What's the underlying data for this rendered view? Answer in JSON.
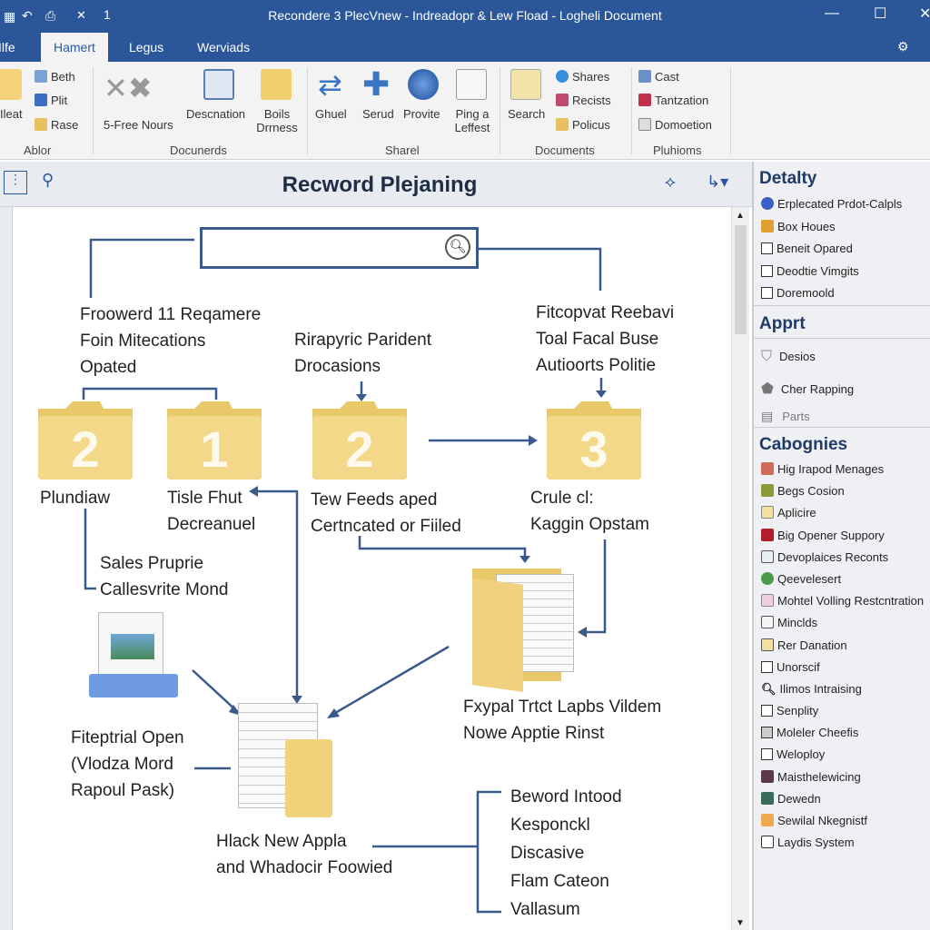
{
  "window": {
    "title": "Recondere 3 PlecVnew - Indreadopr & Lew Fload - Logheli Document",
    "quick_access": "1"
  },
  "tabs": [
    "Ilfe",
    "Hamert",
    "Legus",
    "Werviads"
  ],
  "ribbon": {
    "groups": [
      {
        "label": "Ablor",
        "items": [
          "Ileat",
          "Beth",
          "Plit",
          "Rase"
        ]
      },
      {
        "label": "Docunerds",
        "items": [
          "5-Free Nours",
          "Descnation",
          "Boils Drrness"
        ]
      },
      {
        "label": "Sharel",
        "items": [
          "Ghuel",
          "Serud",
          "Provite",
          "Ping a Leffest"
        ]
      },
      {
        "label": "Documents",
        "items": [
          "Search",
          "Shares",
          "Recists",
          "Policus"
        ]
      },
      {
        "label": "Pluhioms",
        "items": [
          "Cast",
          "Tantzation",
          "Domoetion"
        ]
      }
    ]
  },
  "document": {
    "title": "Recword Plejaning"
  },
  "diagram": {
    "blocks": {
      "b1": [
        "Froowerd 11 Reqamere",
        "Foin Mitecations",
        "Opated"
      ],
      "b2": [
        "Rirapyric Parident",
        "Drocasions"
      ],
      "b3": [
        "Fitcopvat Reebavi",
        "Toal Facal Buse",
        "Autioorts Politie"
      ],
      "f1": "2",
      "f2": "1",
      "f3": "2",
      "f4": "3",
      "l1": [
        "Plundiaw"
      ],
      "l2": [
        "Tisle Fhut",
        "Decreanuel"
      ],
      "l3": [
        "Tew Feeds aped",
        "Certncated or Fiiled"
      ],
      "l4": [
        "Crule cl:",
        "Kaggin Opstam"
      ],
      "l5": [
        "Sales Pruprie",
        "Callesvrite Mond"
      ],
      "l6": [
        "Fiteptrial Open",
        "(Vlodza Mord",
        "Rapoul Pask)"
      ],
      "l7": [
        "Fxypal Trtct Lapbs Vildem",
        "Nowe Apptie Rinst"
      ],
      "l8": [
        "Hlack New Appla",
        "and Whadocir Foowied"
      ],
      "l9": [
        "Beword Intood",
        "Kesponckl",
        "Discasive",
        "Flam Cateon",
        "Vallasum"
      ]
    }
  },
  "pane": {
    "sections": [
      {
        "title": "Detalty",
        "items": [
          "Erplecated Prdot-Calpls",
          "Box Houes",
          "Beneit Opared",
          "Deodtie Vimgits",
          "Doremoold"
        ]
      },
      {
        "title": "Apprt",
        "items": [
          "Desios",
          "Cher Rapping",
          "Parts"
        ]
      },
      {
        "title": "Cabognies",
        "items": [
          "Hig Irapod Menages",
          "Begs Cosion",
          "Aplicire",
          "Big Opener Suppory",
          "Devoplaices Reconts",
          "Qeevelesert",
          "Mohtel Volling Restcntration",
          "Minclds",
          "Rer Danation",
          "Unorscif",
          "Ilimos Intraising",
          "Senplity",
          "Moleler Cheefis",
          "Weloploy",
          "Maisthelewicing",
          "Dewedn",
          "Sewilal Nkegnistf",
          "Laydis System"
        ]
      }
    ]
  },
  "colors": {
    "brand": "#2b579a",
    "folder": "#efd27a",
    "connector": "#3a5a8c"
  }
}
